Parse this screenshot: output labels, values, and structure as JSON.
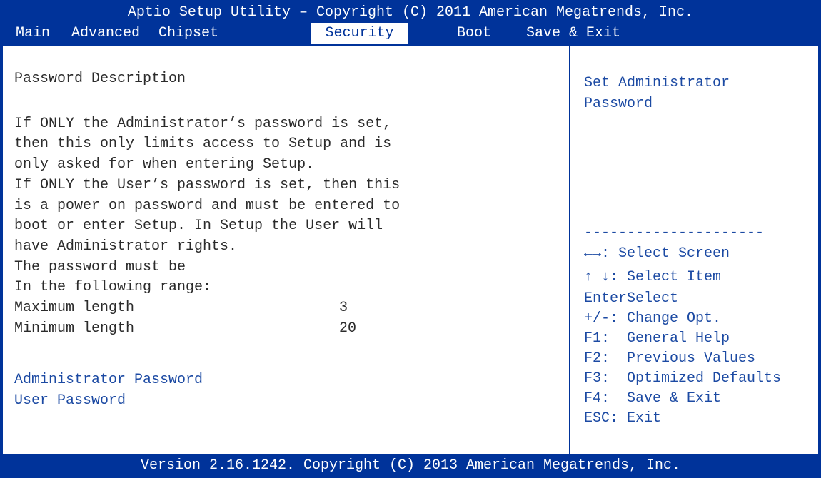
{
  "header": {
    "title": "Aptio Setup Utility – Copyright (C) 2011 American Megatrends, Inc.",
    "tabs": [
      "Main",
      "Advanced",
      "Chipset",
      "Security",
      "Boot",
      "Save & Exit"
    ],
    "active_tab": "Security"
  },
  "left": {
    "section_title": "Password Description",
    "description_lines": [
      "If ONLY the Administrator’s password is set,",
      "then this only limits access to Setup and is",
      "only asked for when entering Setup.",
      "If ONLY the User’s password is set, then this",
      "is a power on password and must be entered to",
      "boot or enter Setup. In Setup the User will",
      "have Administrator rights.",
      "The password must be",
      "In the following range:"
    ],
    "ranges": [
      {
        "label": "Maximum length",
        "value": "3"
      },
      {
        "label": "Minimum length",
        "value": "20"
      }
    ],
    "options": [
      "Administrator Password",
      "User Password"
    ]
  },
  "help": {
    "description_lines": [
      "Set Administrator",
      "Password"
    ],
    "separator": "---------------------",
    "keys": [
      "←→: Select Screen",
      "↑ ↓: Select Item",
      "EnterSelect",
      "+/-: Change Opt.",
      "F1:  General Help",
      "F2:  Previous Values",
      "F3:  Optimized Defaults",
      "F4:  Save & Exit",
      "ESC: Exit"
    ]
  },
  "footer": {
    "version": "Version 2.16.1242. Copyright (C) 2013 American Megatrends, Inc."
  },
  "colors": {
    "header_bg": "#00339a",
    "text": "#2b2b2b",
    "link": "#1c4aa3",
    "background": "#ffffff"
  }
}
